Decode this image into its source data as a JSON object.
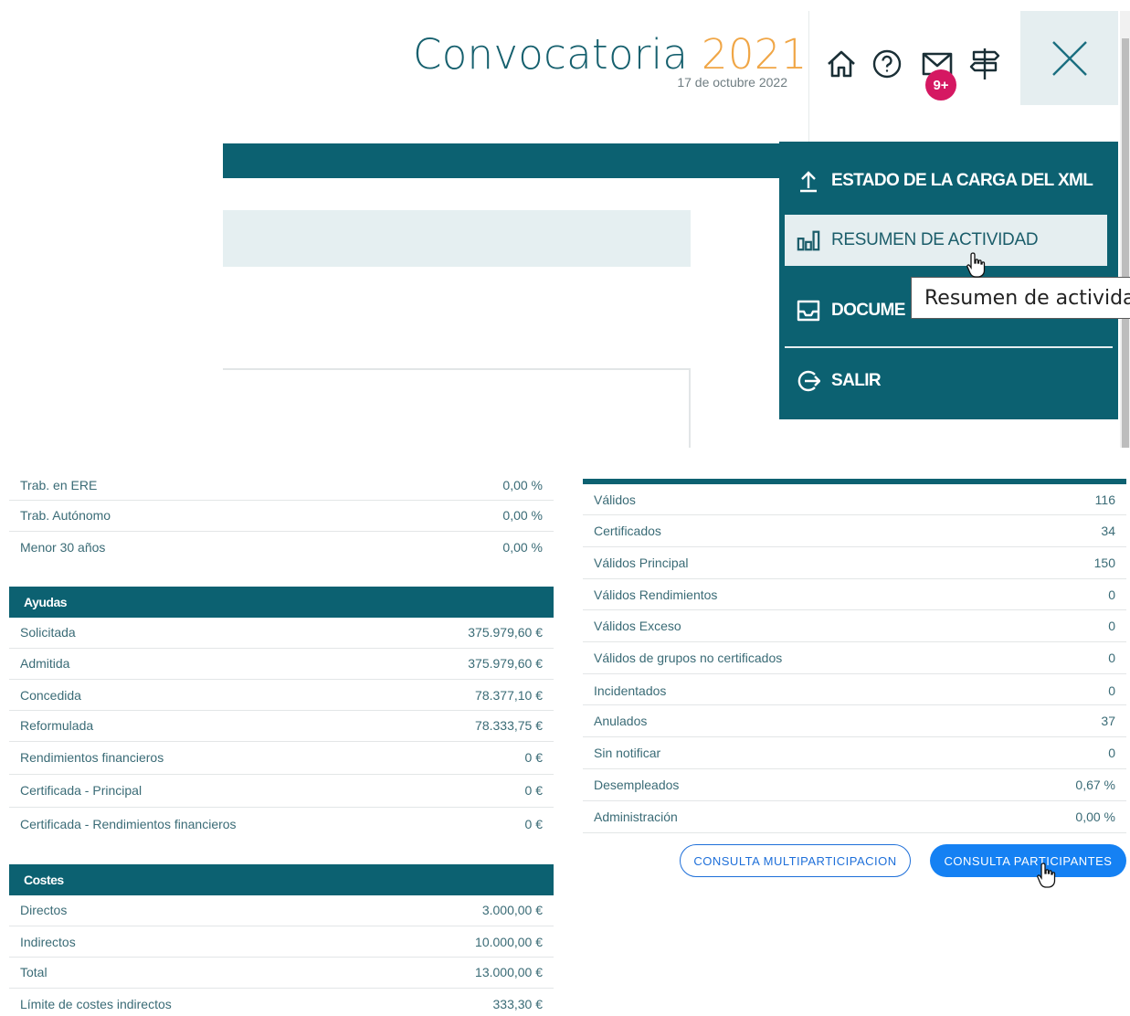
{
  "header": {
    "title_word": "Convocatoria",
    "title_year": "2021",
    "date": "17 de octubre 2022",
    "badge": "9+",
    "icons": [
      "home-icon",
      "help-icon",
      "mail-icon",
      "signpost-icon",
      "close-icon"
    ]
  },
  "menu": {
    "items": [
      {
        "label": "ESTADO DE LA CARGA DEL XML",
        "icon": "upload-icon"
      },
      {
        "label": "RESUMEN DE ACTIVIDAD",
        "icon": "bar-chart-icon"
      },
      {
        "label": "DOCUME",
        "icon": "inbox-icon"
      },
      {
        "label": "SALIR",
        "icon": "logout-icon"
      }
    ],
    "tooltip": "Resumen de actividad"
  },
  "left_table": {
    "top_rows": [
      {
        "label": "Trab. en ERE",
        "value": "0,00 %"
      },
      {
        "label": "Trab. Autónomo",
        "value": "0,00 %"
      },
      {
        "label": "Menor 30 años",
        "value": "0,00 %"
      }
    ],
    "ayudas": {
      "heading": "Ayudas",
      "rows": [
        {
          "label": "Solicitada",
          "value": "375.979,60 €"
        },
        {
          "label": "Admitida",
          "value": "375.979,60 €"
        },
        {
          "label": "Concedida",
          "value": "78.377,10 €"
        },
        {
          "label": "Reformulada",
          "value": "78.333,75 €"
        },
        {
          "label": "Rendimientos financieros",
          "value": "0 €"
        },
        {
          "label": "Certificada - Principal",
          "value": "0 €"
        },
        {
          "label": "Certificada - Rendimientos financieros",
          "value": "0 €"
        }
      ]
    },
    "costes": {
      "heading": "Costes",
      "rows": [
        {
          "label": "Directos",
          "value": "3.000,00 €"
        },
        {
          "label": "Indirectos",
          "value": "10.000,00 €"
        },
        {
          "label": "Total",
          "value": "13.000,00 €"
        },
        {
          "label": "Límite de costes indirectos",
          "value": "333,30 €"
        }
      ]
    }
  },
  "right_table": {
    "rows": [
      {
        "label": "Válidos",
        "value": "116"
      },
      {
        "label": "Certificados",
        "value": "34"
      },
      {
        "label": "Válidos Principal",
        "value": "150"
      },
      {
        "label": "Válidos Rendimientos",
        "value": "0"
      },
      {
        "label": "Válidos Exceso",
        "value": "0"
      },
      {
        "label": "Válidos de grupos no certificados",
        "value": "0"
      },
      {
        "label": "Incidentados",
        "value": "0"
      },
      {
        "label": "Anulados",
        "value": "37"
      },
      {
        "label": "Sin notificar",
        "value": "0"
      },
      {
        "label": "Desempleados",
        "value": "0,67 %"
      },
      {
        "label": "Administración",
        "value": "0,00 %"
      }
    ]
  },
  "buttons": {
    "multiparticipacion": "CONSULTA MULTIPARTICIPACION",
    "participantes": "CONSULTA PARTICIPANTES"
  },
  "colors": {
    "teal": "#0c6171",
    "accent_orange": "#f0a646",
    "badge": "#d51862",
    "primary_blue": "#1581f3"
  }
}
